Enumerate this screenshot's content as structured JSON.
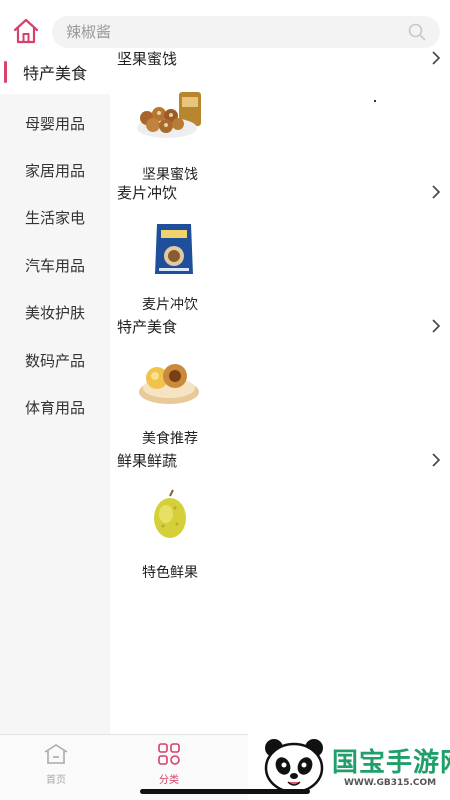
{
  "search": {
    "placeholder": "辣椒酱"
  },
  "sidebar": {
    "items": [
      {
        "label": "特产美食",
        "active": true
      },
      {
        "label": "母婴用品"
      },
      {
        "label": "家居用品"
      },
      {
        "label": "生活家电"
      },
      {
        "label": "汽车用品"
      },
      {
        "label": "美妆护肤"
      },
      {
        "label": "数码产品"
      },
      {
        "label": "体育用品"
      }
    ]
  },
  "sections": [
    {
      "title": "坚果蜜饯",
      "tile_label": "坚果蜜饯",
      "icon": "nuts-product-image"
    },
    {
      "title": "麦片冲饮",
      "tile_label": "麦片冲饮",
      "icon": "oatmeal-product-image"
    },
    {
      "title": "特产美食",
      "tile_label": "美食推荐",
      "icon": "pastry-product-image"
    },
    {
      "title": "鲜果鲜蔬",
      "tile_label": "特色鲜果",
      "icon": "durian-product-image"
    }
  ],
  "bottom_nav": {
    "tabs": [
      {
        "label": "首页",
        "icon": "home-icon",
        "active": false
      },
      {
        "label": "分类",
        "icon": "category-grid-icon",
        "active": true
      }
    ]
  },
  "watermark": {
    "title": "国宝手游网",
    "url": "WWW.GB315.COM"
  },
  "colors": {
    "accent": "#d6426a",
    "sidebar_bg": "#f6f6f6",
    "watermark_green": "#1fa06a"
  }
}
